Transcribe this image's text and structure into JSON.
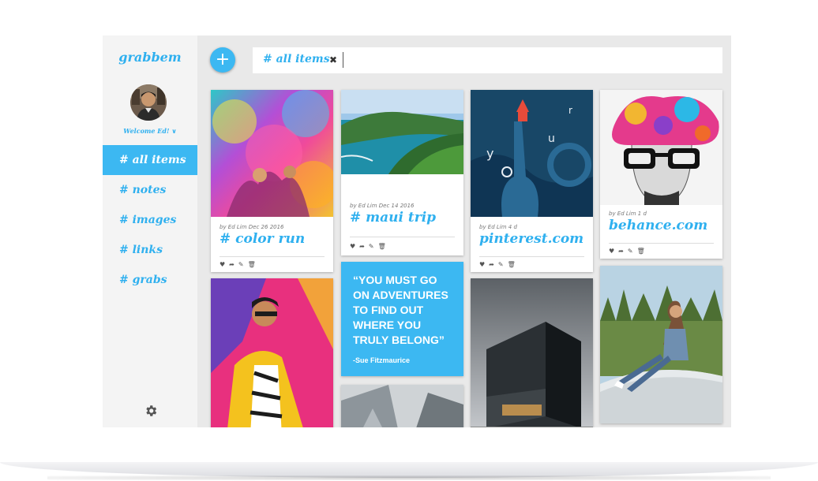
{
  "app": {
    "name": "grabbem",
    "accent": "#3cb8f2",
    "title_color": "#2fb0ef"
  },
  "sidebar": {
    "welcome": "Welcome Ed! ∨",
    "items": [
      {
        "label": "# all items",
        "active": true
      },
      {
        "label": "# notes",
        "active": false
      },
      {
        "label": "# images",
        "active": false
      },
      {
        "label": "# links",
        "active": false
      },
      {
        "label": "# grabs",
        "active": false
      }
    ],
    "settings_icon": "gear-icon"
  },
  "toolbar": {
    "add_label": "+",
    "search_tag": "# all items",
    "clear_label": "✖",
    "search_value": ""
  },
  "cards": {
    "color_run": {
      "byline": "by Ed Lim Dec 26 2016",
      "title": "# color run"
    },
    "maui_trip": {
      "byline": "by Ed Lim Dec 14 2016",
      "title": "# maui trip"
    },
    "pinterest": {
      "byline": "by Ed Lim 4 d",
      "title": "pinterest.com"
    },
    "behance": {
      "byline": "by Ed Lim 1 d",
      "title": "behance.com"
    },
    "quote": {
      "text": "“YOU MUST GO ON ADVENTURES TO FIND OUT WHERE YOU TRULY BELONG”",
      "author": "-Sue Fitzmaurice"
    }
  },
  "actions": [
    "heart-icon",
    "share-icon",
    "edit-icon",
    "trash-icon"
  ]
}
